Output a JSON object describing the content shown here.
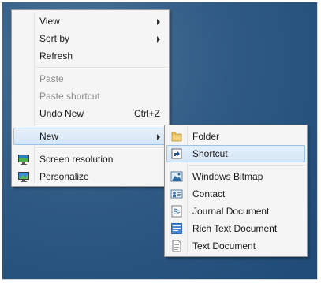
{
  "context_menu": {
    "items": [
      {
        "label": "View"
      },
      {
        "label": "Sort by"
      },
      {
        "label": "Refresh"
      },
      {
        "label": "Paste"
      },
      {
        "label": "Paste shortcut"
      },
      {
        "label": "Undo New",
        "shortcut": "Ctrl+Z"
      },
      {
        "label": "New"
      },
      {
        "label": "Screen resolution",
        "icon": "monitor-icon"
      },
      {
        "label": "Personalize",
        "icon": "personalize-icon"
      }
    ]
  },
  "new_submenu": {
    "items": [
      {
        "label": "Folder",
        "icon": "folder-icon"
      },
      {
        "label": "Shortcut",
        "icon": "shortcut-icon"
      },
      {
        "label": "Windows Bitmap",
        "icon": "bitmap-icon"
      },
      {
        "label": "Contact",
        "icon": "contact-icon"
      },
      {
        "label": "Journal Document",
        "icon": "journal-icon"
      },
      {
        "label": "Rich Text Document",
        "icon": "rich-text-icon"
      },
      {
        "label": "Text Document",
        "icon": "text-document-icon"
      }
    ]
  },
  "colors": {
    "desktop": "#2f5a84",
    "highlight": "#d4e6f7",
    "highlight_border": "#99c2e8"
  }
}
